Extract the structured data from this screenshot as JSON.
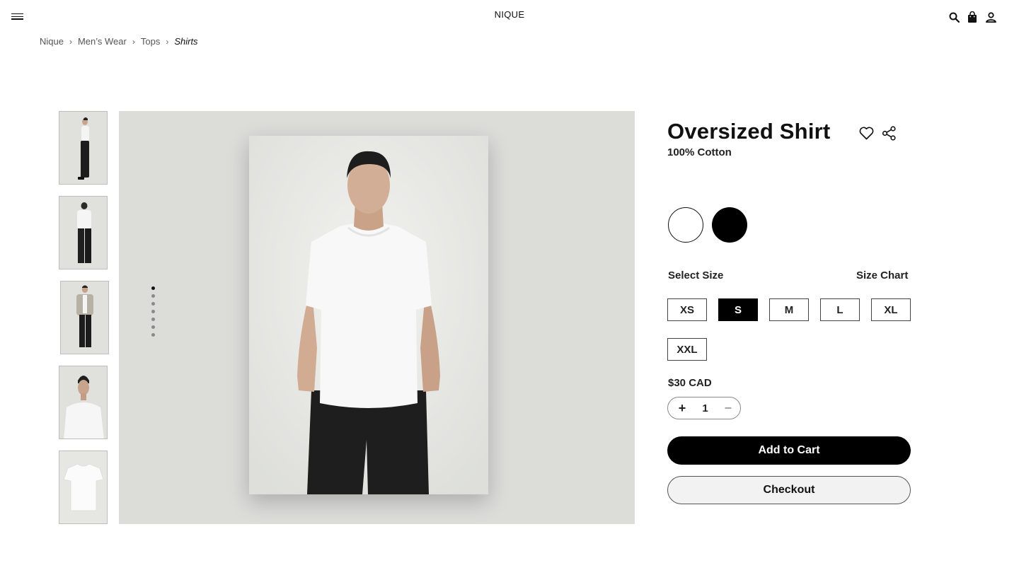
{
  "header": {
    "brand": "NIQUE",
    "icons": [
      "menu-icon",
      "search-icon",
      "shopping-bag-icon",
      "account-icon"
    ]
  },
  "breadcrumb": {
    "items": [
      "Nique",
      "Men’s Wear",
      "Tops"
    ],
    "current": "Shirts",
    "separator": "›"
  },
  "gallery": {
    "thumbnail_count": 5,
    "dot_count": 7,
    "active_dot": 1,
    "background": "#dcdcd9"
  },
  "product": {
    "title": "Oversized Shirt",
    "material": "100% Cotton",
    "colors": [
      {
        "name": "white",
        "hex": "#ffffff",
        "selected": true
      },
      {
        "name": "black",
        "hex": "#000000",
        "selected": false
      }
    ],
    "select_size_label": "Select Size",
    "size_chart_label": "Size Chart",
    "sizes": [
      "XS",
      "S",
      "M",
      "L",
      "XL",
      "XXL"
    ],
    "selected_size": "S",
    "price": "$30 CAD",
    "quantity": {
      "plus": "+",
      "value": "1",
      "minus": "–"
    },
    "add_to_cart_label": "Add to Cart",
    "checkout_label": "Checkout"
  },
  "colors": {
    "primary": "#000000",
    "text": "#111111",
    "checkout_bg": "#f2f2f2"
  }
}
